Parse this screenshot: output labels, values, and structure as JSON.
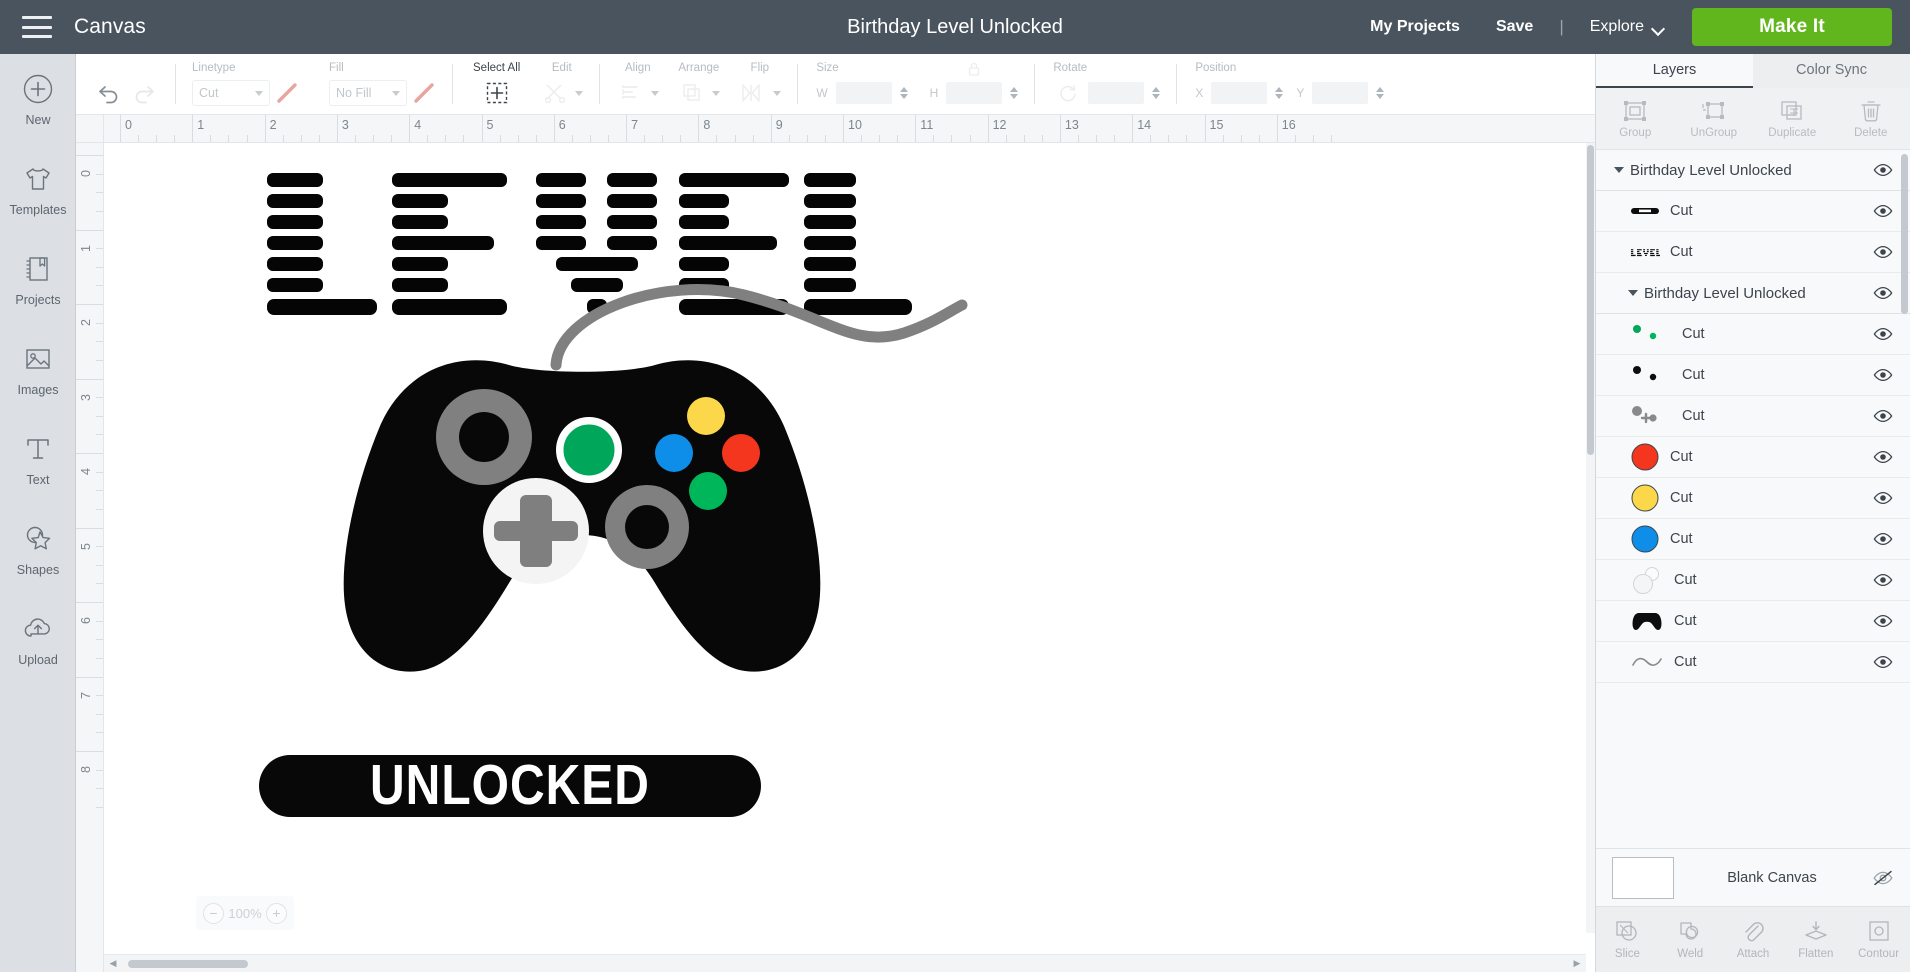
{
  "topbar": {
    "menu_icon": "hamburger-icon",
    "canvas_label": "Canvas",
    "document_title": "Birthday Level Unlocked",
    "my_projects": "My Projects",
    "save": "Save",
    "separator": "|",
    "explore": "Explore",
    "make_it": "Make It",
    "bg_color": "#4a545e",
    "make_it_color": "#62b61d"
  },
  "rail": {
    "items": [
      {
        "label": "New",
        "icon": "plus-circle-icon"
      },
      {
        "label": "Templates",
        "icon": "tshirt-icon"
      },
      {
        "label": "Projects",
        "icon": "book-bookmark-icon"
      },
      {
        "label": "Images",
        "icon": "picture-icon"
      },
      {
        "label": "Text",
        "icon": "text-t-icon"
      },
      {
        "label": "Shapes",
        "icon": "star-shapes-icon"
      },
      {
        "label": "Upload",
        "icon": "cloud-upload-icon"
      }
    ]
  },
  "toolbar": {
    "undo": "undo-icon",
    "redo": "redo-icon",
    "linetype": {
      "caption": "Linetype",
      "value": "Cut",
      "swatch": "line-swatch-icon"
    },
    "fill": {
      "caption": "Fill",
      "value": "No Fill",
      "swatch": "fill-swatch-icon"
    },
    "select_all": {
      "caption": "Select All",
      "icon": "select-all-icon"
    },
    "edit": {
      "caption": "Edit",
      "icon": "edit-scissors-icon"
    },
    "align": {
      "caption": "Align",
      "icon": "align-icon"
    },
    "arrange": {
      "caption": "Arrange",
      "icon": "arrange-icon"
    },
    "flip": {
      "caption": "Flip",
      "icon": "flip-icon"
    },
    "size": {
      "caption": "Size",
      "lock": "lock-icon",
      "w_label": "W",
      "w_value": "",
      "h_label": "H",
      "h_value": ""
    },
    "rotate": {
      "caption": "Rotate",
      "icon": "rotate-icon",
      "value": ""
    },
    "position": {
      "caption": "Position",
      "x_label": "X",
      "x_value": "",
      "y_label": "Y",
      "y_value": ""
    }
  },
  "canvas": {
    "zoom": {
      "minus": "−",
      "value": "100%",
      "plus": "+"
    },
    "ruler_h": [
      "0",
      "1",
      "2",
      "3",
      "4",
      "5",
      "6",
      "7",
      "8",
      "9",
      "10",
      "11",
      "12",
      "13",
      "14",
      "15",
      "16"
    ],
    "ruler_v": [
      "0",
      "1",
      "2",
      "3",
      "4",
      "5",
      "6",
      "7",
      "8"
    ],
    "artwork": {
      "title_word": "LEVEL",
      "banner_word": "UNLOCKED",
      "controller": {
        "body_color": "#080808",
        "cable_color": "#808080",
        "dpad_bg": "#f2f2f2",
        "dpad_cross": "#7f7f7f",
        "stick_ring": "#808080",
        "green_stick": "#00a65a",
        "buttons": [
          {
            "name": "yellow-button",
            "color": "#fcd74a"
          },
          {
            "name": "blue-button",
            "color": "#0e8ee8"
          },
          {
            "name": "red-button",
            "color": "#f4361e"
          },
          {
            "name": "green-button",
            "color": "#00b65a"
          }
        ]
      }
    }
  },
  "right_panel": {
    "tabs": [
      {
        "label": "Layers",
        "selected": true
      },
      {
        "label": "Color Sync",
        "selected": false
      }
    ],
    "ops": [
      {
        "label": "Group",
        "icon": "group-icon"
      },
      {
        "label": "UnGroup",
        "icon": "ungroup-icon"
      },
      {
        "label": "Duplicate",
        "icon": "duplicate-icon"
      },
      {
        "label": "Delete",
        "icon": "trash-icon"
      }
    ],
    "layers": [
      {
        "name": "Birthday Level Unlocked",
        "type": "group",
        "caret": true,
        "indent": false,
        "thumb": "none",
        "eye": "eye-icon"
      },
      {
        "name": "Cut",
        "type": "item",
        "caret": false,
        "indent": true,
        "thumb": "banner-bar",
        "eye": "eye-icon"
      },
      {
        "name": "Cut",
        "type": "item",
        "caret": false,
        "indent": true,
        "thumb": "level-text",
        "eye": "eye-icon"
      },
      {
        "name": "Birthday Level Unlocked",
        "type": "group",
        "caret": true,
        "indent": true,
        "thumb": "none",
        "eye": "eye-icon"
      },
      {
        "name": "Cut",
        "type": "item",
        "caret": false,
        "indent": true,
        "thumb": "green-dots",
        "eye": "eye-icon"
      },
      {
        "name": "Cut",
        "type": "item",
        "caret": false,
        "indent": true,
        "thumb": "black-dots",
        "eye": "eye-icon"
      },
      {
        "name": "Cut",
        "type": "item",
        "caret": false,
        "indent": true,
        "thumb": "gray-dots",
        "eye": "eye-icon"
      },
      {
        "name": "Cut",
        "type": "item",
        "caret": false,
        "indent": true,
        "thumb": "red-circle",
        "eye": "eye-icon"
      },
      {
        "name": "Cut",
        "type": "item",
        "caret": false,
        "indent": true,
        "thumb": "yellow-circle",
        "eye": "eye-icon"
      },
      {
        "name": "Cut",
        "type": "item",
        "caret": false,
        "indent": true,
        "thumb": "blue-circle",
        "eye": "eye-icon"
      },
      {
        "name": "Cut",
        "type": "item",
        "caret": false,
        "indent": true,
        "thumb": "white-circles",
        "eye": "eye-icon"
      },
      {
        "name": "Cut",
        "type": "item",
        "caret": false,
        "indent": true,
        "thumb": "controller-body",
        "eye": "eye-icon"
      },
      {
        "name": "Cut",
        "type": "item",
        "caret": false,
        "indent": true,
        "thumb": "cable-wave",
        "eye": "eye-icon"
      }
    ],
    "blank_canvas": {
      "label": "Blank Canvas",
      "eye": "eye-slash-icon"
    },
    "bottom_ops": [
      {
        "label": "Slice",
        "icon": "slice-icon"
      },
      {
        "label": "Weld",
        "icon": "weld-icon"
      },
      {
        "label": "Attach",
        "icon": "paperclip-icon"
      },
      {
        "label": "Flatten",
        "icon": "flatten-icon"
      },
      {
        "label": "Contour",
        "icon": "contour-icon"
      }
    ]
  }
}
